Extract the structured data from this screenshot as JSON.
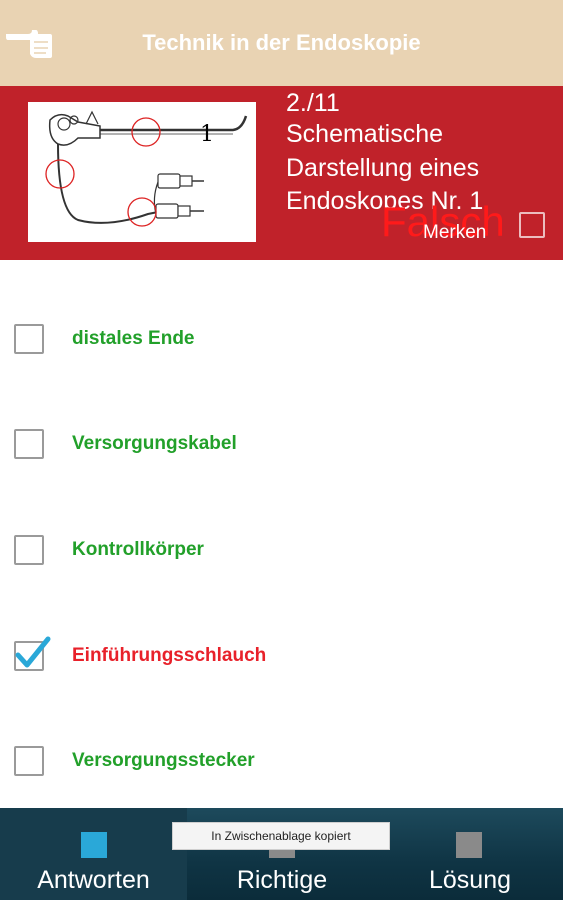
{
  "header": {
    "title": "Technik in der Endoskopie",
    "back_icon": "pointing-hand-icon",
    "bg_color": "#e9d3b3"
  },
  "question": {
    "counter": "2./11",
    "text": "Schematische Darstellung eines Endoskopes Nr. 1",
    "image_label": "1",
    "result": "Falsch",
    "bookmark_label": "Merken",
    "bg_color": "#c0222a"
  },
  "answers": [
    {
      "label": "distales Ende",
      "checked": false,
      "status": "correct"
    },
    {
      "label": "Versorgungskabel",
      "checked": false,
      "status": "correct"
    },
    {
      "label": "Kontrollkörper",
      "checked": false,
      "status": "correct"
    },
    {
      "label": "Einführungsschlauch",
      "checked": true,
      "status": "wrong"
    },
    {
      "label": "Versorgungsstecker",
      "checked": false,
      "status": "correct"
    }
  ],
  "colors": {
    "correct": "#22a02a",
    "wrong": "#e8212a",
    "accent": "#2aa8d8"
  },
  "bottom_nav": [
    {
      "label": "Antworten",
      "active": true
    },
    {
      "label": "Richtige",
      "active": false
    },
    {
      "label": "Lösung",
      "active": false
    }
  ],
  "toast": "In Zwischenablage kopiert"
}
